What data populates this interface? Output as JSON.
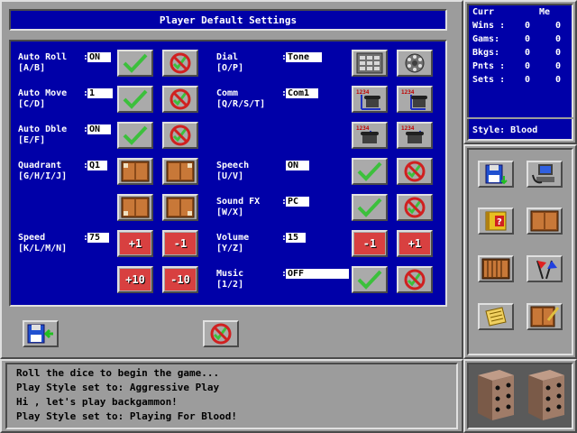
{
  "dialog": {
    "title": "Player Default Settings",
    "auto_roll": {
      "label": "Auto Roll",
      "keys": "[A/B]",
      "value": "ON"
    },
    "auto_move": {
      "label": "Auto Move",
      "keys": "[C/D]",
      "value": "1"
    },
    "auto_dble": {
      "label": "Auto Dble",
      "keys": "[E/F]",
      "value": "ON"
    },
    "quadrant": {
      "label": "Quadrant",
      "keys": "[G/H/I/J]",
      "value": "Q1"
    },
    "speed": {
      "label": "Speed",
      "keys": "[K/L/M/N]",
      "value": "75"
    },
    "dial": {
      "label": "Dial",
      "keys": "[O/P]",
      "value": "Tone"
    },
    "comm": {
      "label": "Comm",
      "keys": "[Q/R/S/T]",
      "value": "Com1"
    },
    "speech": {
      "label": "Speech",
      "keys": "[U/V]",
      "value": "ON"
    },
    "sound_fx": {
      "label": "Sound FX",
      "keys": "[W/X]",
      "value": "PC"
    },
    "volume": {
      "label": "Volume",
      "keys": "[Y/Z]",
      "value": "15"
    },
    "music": {
      "label": "Music",
      "keys": "[1/2]",
      "value": "OFF"
    },
    "buttons": {
      "plus1": "+1",
      "minus1": "-1",
      "plus10": "+10",
      "minus10": "-10"
    }
  },
  "stats": {
    "col_curr": "Curr",
    "col_me": "Me",
    "rows": [
      {
        "label": "Wins :",
        "curr": "0",
        "me": "0"
      },
      {
        "label": "Gams:",
        "curr": "0",
        "me": "0"
      },
      {
        "label": "Bkgs:",
        "curr": "0",
        "me": "0"
      },
      {
        "label": "Pnts :",
        "curr": "0",
        "me": "0"
      },
      {
        "label": "Sets :",
        "curr": "0",
        "me": "0"
      }
    ],
    "style": "Style: Blood"
  },
  "messages": [
    "Roll the dice to begin the game...",
    "Play Style set to: Aggressive Play",
    "Hi , let's play backgammon!",
    "Play Style set to: Playing For Blood!"
  ],
  "colors": {
    "panel": "#0000a8",
    "frame": "#9c9c9c",
    "check": "#3cc03c",
    "no": "#d02020"
  }
}
